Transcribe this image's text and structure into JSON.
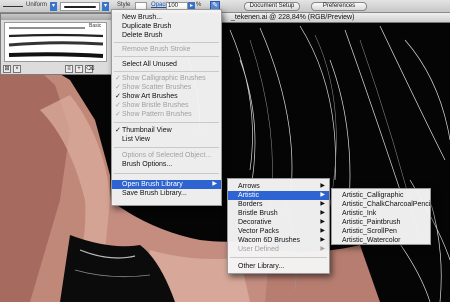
{
  "control_bar": {
    "stroke_label": "Uniform",
    "style_label": "Style",
    "opacity_label": "Opacity",
    "opacity_value": "100",
    "percent": "%",
    "document_setup": "Document Setup",
    "preferences": "Preferences"
  },
  "document": {
    "title": "_tekenen.ai @ 228,84% (RGB/Preview)"
  },
  "brush_panel": {
    "basic_label": "Basic"
  },
  "main_menu": {
    "items": [
      {
        "label": "New Brush...",
        "enabled": true
      },
      {
        "label": "Duplicate Brush",
        "enabled": true
      },
      {
        "label": "Delete Brush",
        "enabled": true
      },
      {
        "label": "Remove Brush Stroke",
        "enabled": false
      },
      {
        "label": "Select All Unused",
        "enabled": true
      },
      {
        "label": "Show Calligraphic Brushes",
        "enabled": false,
        "checked": true
      },
      {
        "label": "Show Scatter Brushes",
        "enabled": false,
        "checked": true
      },
      {
        "label": "Show Art Brushes",
        "enabled": true,
        "checked": true
      },
      {
        "label": "Show Bristle Brushes",
        "enabled": false,
        "checked": true
      },
      {
        "label": "Show Pattern Brushes",
        "enabled": false,
        "checked": true
      },
      {
        "label": "Thumbnail View",
        "enabled": true,
        "checked": true
      },
      {
        "label": "List View",
        "enabled": true
      },
      {
        "label": "Options of Selected Object...",
        "enabled": false
      },
      {
        "label": "Brush Options...",
        "enabled": true
      },
      {
        "label": "Open Brush Library",
        "enabled": true,
        "submenu": true,
        "highlighted": true
      },
      {
        "label": "Save Brush Library...",
        "enabled": true
      }
    ]
  },
  "library_menu": {
    "items": [
      {
        "label": "Arrows",
        "submenu": true
      },
      {
        "label": "Artistic",
        "submenu": true,
        "highlighted": true
      },
      {
        "label": "Borders",
        "submenu": true
      },
      {
        "label": "Bristle Brush",
        "submenu": true
      },
      {
        "label": "Decorative",
        "submenu": true
      },
      {
        "label": "Vector Packs",
        "submenu": true
      },
      {
        "label": "Wacom 6D Brushes",
        "submenu": true
      },
      {
        "label": "User Defined",
        "submenu": true,
        "enabled": false
      },
      {
        "label": "Other Library..."
      }
    ]
  },
  "artistic_menu": {
    "items": [
      "Artistic_Calligraphic",
      "Artistic_ChalkCharcoalPencil",
      "Artistic_Ink",
      "Artistic_Paintbrush",
      "Artistic_ScrollPen",
      "Artistic_Watercolor"
    ]
  },
  "colors": {
    "highlight": "#2e64d2",
    "canvas": "#050505",
    "skin": "#c99a8a"
  }
}
